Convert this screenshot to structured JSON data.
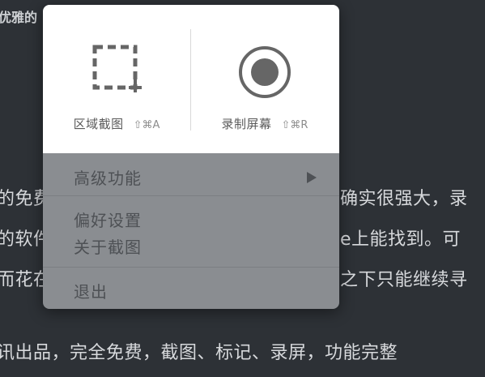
{
  "background": {
    "heading_fragment": "优雅的",
    "lines": [
      {
        "left": "的免费",
        "right": "确实很强大，录"
      },
      {
        "left": "的软件",
        "right": "e上能找到。可"
      },
      {
        "left": "而花在",
        "right": "之下只能继续寻"
      },
      {
        "left": "",
        "right": ""
      },
      {
        "full": "讯出品，完全免费，截图、标记、录屏，功能完整"
      }
    ]
  },
  "popover": {
    "actions": [
      {
        "label": "区域截图",
        "shortcut": "⇧⌘A",
        "icon": "region-select-icon"
      },
      {
        "label": "录制屏幕",
        "shortcut": "⇧⌘R",
        "icon": "record-icon"
      }
    ],
    "menu": {
      "advanced": "高级功能",
      "preferences": "偏好设置",
      "about": "关于截图",
      "quit": "退出"
    }
  }
}
